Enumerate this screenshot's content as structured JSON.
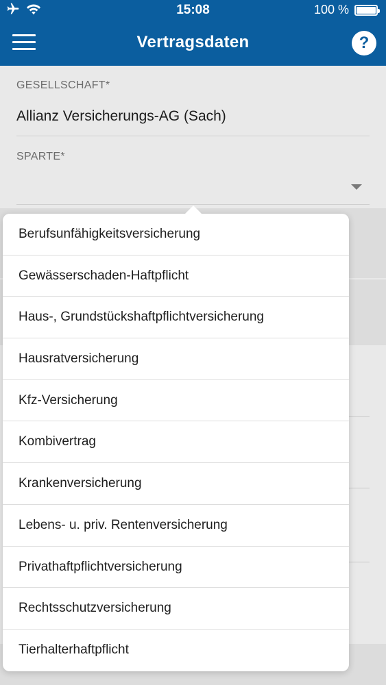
{
  "status_bar": {
    "time": "15:08",
    "battery_percent": "100 %",
    "airplane_icon": "airplane-icon",
    "wifi_icon": "wifi-icon"
  },
  "nav": {
    "title": "Vertragsdaten",
    "help_label": "?"
  },
  "form": {
    "gesellschaft": {
      "label": "GESELLSCHAFT*",
      "value": "Allianz Versicherungs-AG (Sach)"
    },
    "sparte": {
      "label": "SPARTE*",
      "value": ""
    }
  },
  "sparte_options": [
    "Berufsunfähigkeitsversicherung",
    "Gewässerschaden-Haftpflicht",
    "Haus-, Grundstückshaftpflichtversicherung",
    "Hausratversicherung",
    "Kfz-Versicherung",
    "Kombivertrag",
    "Krankenversicherung",
    "Lebens- u. priv. Rentenversicherung",
    "Privathaftpflichtversicherung",
    "Rechtsschutzversicherung",
    "Tierhalterhaftpflicht"
  ],
  "colors": {
    "brand_blue": "#0b5e9f",
    "background": "#e9e9e9",
    "popover": "#ffffff"
  }
}
